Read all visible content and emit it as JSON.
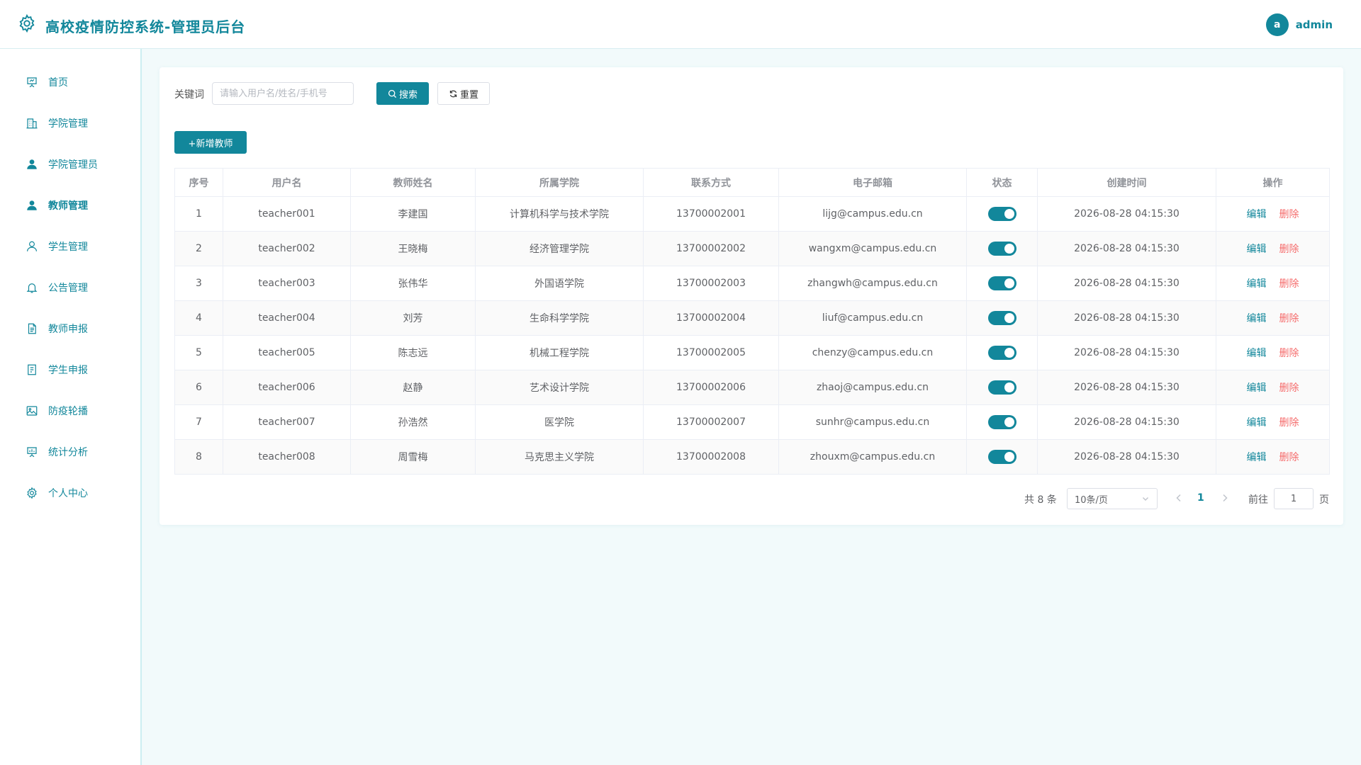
{
  "header": {
    "title": "高校疫情防控系统-管理员后台",
    "avatar_letter": "a",
    "username": "admin"
  },
  "sidebar": {
    "items": [
      {
        "label": "首页",
        "icon": "presentation-icon"
      },
      {
        "label": "学院管理",
        "icon": "building-icon"
      },
      {
        "label": "学院管理员",
        "icon": "user-solid-icon"
      },
      {
        "label": "教师管理",
        "icon": "user-solid-icon"
      },
      {
        "label": "学生管理",
        "icon": "user-outline-icon"
      },
      {
        "label": "公告管理",
        "icon": "bell-icon"
      },
      {
        "label": "教师申报",
        "icon": "document-icon"
      },
      {
        "label": "学生申报",
        "icon": "tickets-icon"
      },
      {
        "label": "防疫轮播",
        "icon": "picture-icon"
      },
      {
        "label": "统计分析",
        "icon": "data-board-icon"
      },
      {
        "label": "个人中心",
        "icon": "gear-icon"
      }
    ],
    "active_index": 3
  },
  "search": {
    "label": "关键词",
    "placeholder": "请输入用户名/姓名/手机号",
    "value": "",
    "search_label": "搜索",
    "reset_label": "重置"
  },
  "toolbar": {
    "add_label": "+新增教师"
  },
  "table": {
    "columns": [
      "序号",
      "用户名",
      "教师姓名",
      "所属学院",
      "联系方式",
      "电子邮箱",
      "状态",
      "创建时间",
      "操作"
    ],
    "edit_label": "编辑",
    "delete_label": "删除",
    "rows": [
      {
        "no": "1",
        "username": "teacher001",
        "name": "李建国",
        "college": "计算机科学与技术学院",
        "phone": "13700002001",
        "email": "lijg@campus.edu.cn",
        "enabled": true,
        "created": "2026-08-28 04:15:30"
      },
      {
        "no": "2",
        "username": "teacher002",
        "name": "王晓梅",
        "college": "经济管理学院",
        "phone": "13700002002",
        "email": "wangxm@campus.edu.cn",
        "enabled": true,
        "created": "2026-08-28 04:15:30"
      },
      {
        "no": "3",
        "username": "teacher003",
        "name": "张伟华",
        "college": "外国语学院",
        "phone": "13700002003",
        "email": "zhangwh@campus.edu.cn",
        "enabled": true,
        "created": "2026-08-28 04:15:30"
      },
      {
        "no": "4",
        "username": "teacher004",
        "name": "刘芳",
        "college": "生命科学学院",
        "phone": "13700002004",
        "email": "liuf@campus.edu.cn",
        "enabled": true,
        "created": "2026-08-28 04:15:30"
      },
      {
        "no": "5",
        "username": "teacher005",
        "name": "陈志远",
        "college": "机械工程学院",
        "phone": "13700002005",
        "email": "chenzy@campus.edu.cn",
        "enabled": true,
        "created": "2026-08-28 04:15:30"
      },
      {
        "no": "6",
        "username": "teacher006",
        "name": "赵静",
        "college": "艺术设计学院",
        "phone": "13700002006",
        "email": "zhaoj@campus.edu.cn",
        "enabled": true,
        "created": "2026-08-28 04:15:30"
      },
      {
        "no": "7",
        "username": "teacher007",
        "name": "孙浩然",
        "college": "医学院",
        "phone": "13700002007",
        "email": "sunhr@campus.edu.cn",
        "enabled": true,
        "created": "2026-08-28 04:15:30"
      },
      {
        "no": "8",
        "username": "teacher008",
        "name": "周雪梅",
        "college": "马克思主义学院",
        "phone": "13700002008",
        "email": "zhouxm@campus.edu.cn",
        "enabled": true,
        "created": "2026-08-28 04:15:30"
      }
    ]
  },
  "pagination": {
    "total_text": "共 8 条",
    "page_size": "10条/页",
    "current_page": "1",
    "goto_prefix": "前往",
    "goto_value": "1",
    "goto_suffix": "页"
  },
  "colors": {
    "primary": "#12879b",
    "danger": "#f56c6c",
    "background": "#f2fafb"
  }
}
